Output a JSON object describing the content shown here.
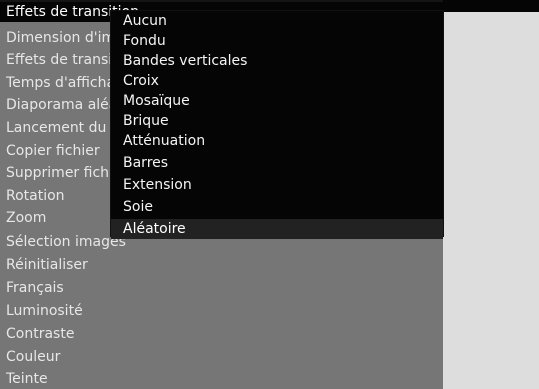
{
  "settings_menu": {
    "items": [
      {
        "label": "Effets de transition"
      },
      {
        "label": "Dimension d'image"
      },
      {
        "label": "Effets de transition"
      },
      {
        "label": "Temps d'affichage"
      },
      {
        "label": "Diaporama aléatoire"
      },
      {
        "label": "Lancement du diaporama"
      },
      {
        "label": "Copier fichier"
      },
      {
        "label": "Supprimer fichier"
      },
      {
        "label": "Rotation"
      },
      {
        "label": "Zoom"
      },
      {
        "label": "Sélection images"
      },
      {
        "label": "Réinitialiser"
      },
      {
        "label": "Français"
      },
      {
        "label": "Luminosité"
      },
      {
        "label": "Contraste"
      },
      {
        "label": "Couleur"
      },
      {
        "label": "Teinte"
      }
    ]
  },
  "dropdown": {
    "options": [
      {
        "label": "Aucun"
      },
      {
        "label": "Fondu"
      },
      {
        "label": "Bandes verticales"
      },
      {
        "label": "Croix"
      },
      {
        "label": "Mosaïque"
      },
      {
        "label": "Brique"
      },
      {
        "label": "Atténuation"
      },
      {
        "label": "Barres"
      },
      {
        "label": "Extension"
      },
      {
        "label": "Soie"
      },
      {
        "label": "Aléatoire"
      }
    ],
    "highlighted": "Aléatoire"
  },
  "colors": {
    "menu_background": "#767676",
    "dropdown_background": "#050505",
    "highlight_background": "#222222",
    "side_panel": "#dddddd"
  }
}
